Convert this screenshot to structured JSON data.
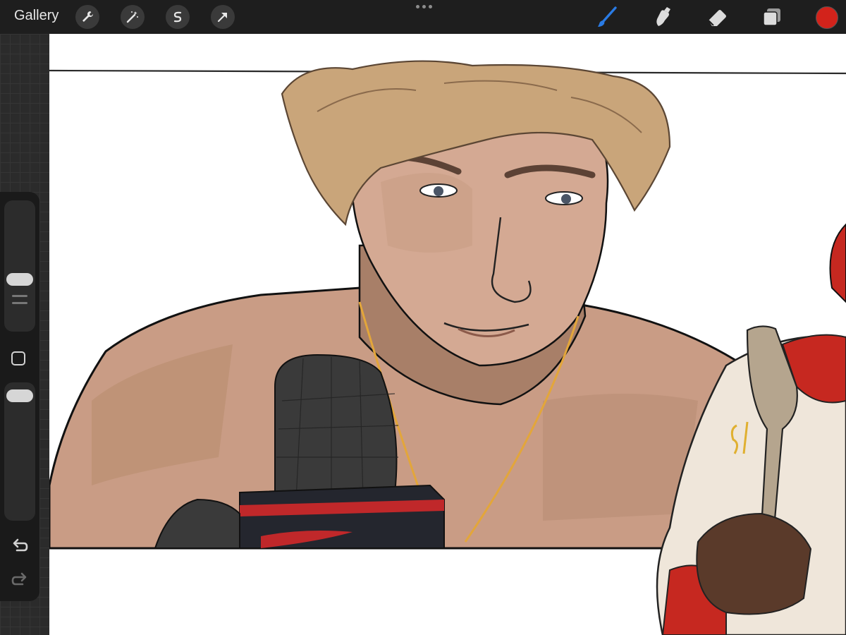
{
  "toolbar": {
    "gallery_label": "Gallery",
    "left_tools": [
      "wrench-icon",
      "magic-wand-icon",
      "selection-icon",
      "transform-arrow-icon"
    ],
    "right_tools": [
      "brush-icon",
      "smudge-icon",
      "eraser-icon",
      "layers-icon"
    ],
    "active_tool": "brush-icon",
    "active_color": "#d2231b",
    "accent_color": "#2a7be4"
  },
  "sidebar": {
    "brush_size_level": 0.38,
    "opacity_level": 0.96,
    "modify_button": "square-icon",
    "undo": "undo-icon",
    "redo": "redo-icon"
  },
  "canvas": {
    "artwork": "illustration"
  }
}
